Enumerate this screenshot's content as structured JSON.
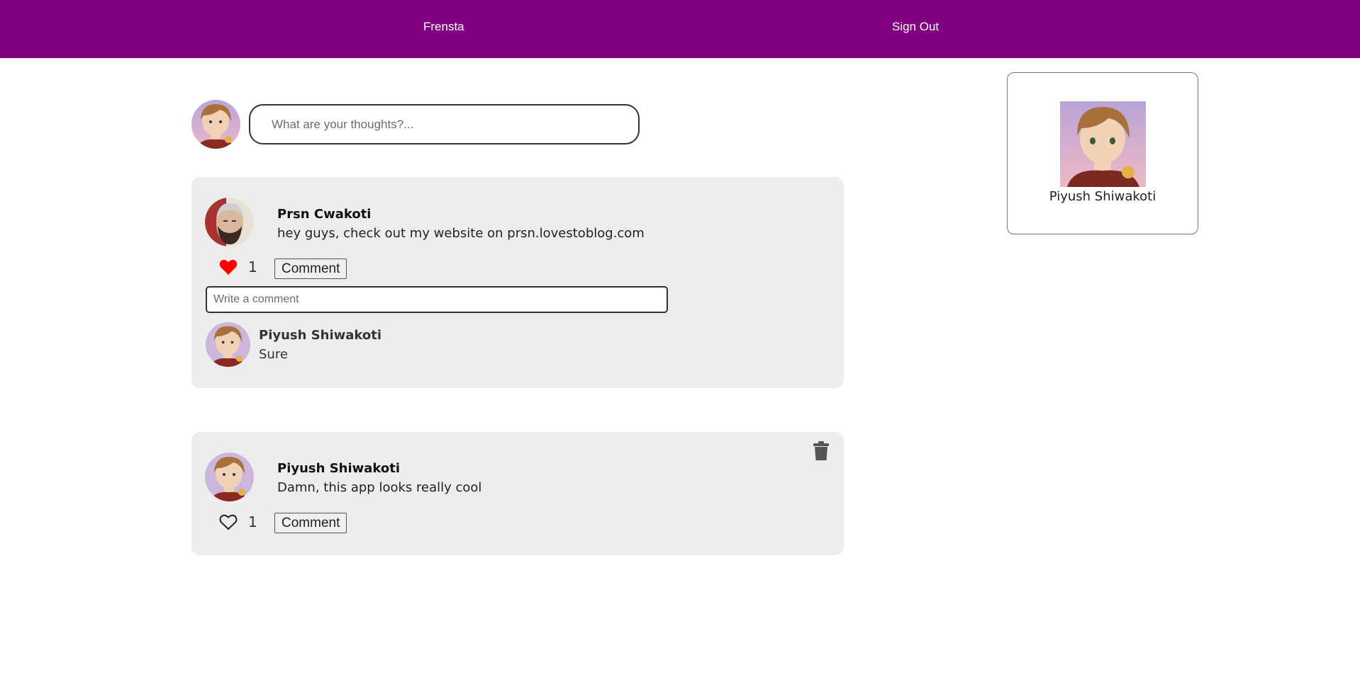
{
  "nav": {
    "brand": "Frensta",
    "sign_out": "Sign Out",
    "background": "#800080"
  },
  "composer": {
    "placeholder": "What are your thoughts?..."
  },
  "posts": [
    {
      "author": "Prsn Cwakoti",
      "text": "hey guys, check out my website on prsn.lovestoblog.com",
      "likes": "1",
      "liked": true,
      "comment_label": "Comment",
      "comment_placeholder": "Write a comment",
      "comments": [
        {
          "author": "Piyush Shiwakoti",
          "text": "Sure"
        }
      ]
    },
    {
      "author": "Piyush Shiwakoti",
      "text": "Damn, this app looks really cool",
      "likes": "1",
      "liked": false,
      "comment_label": "Comment",
      "deletable": true
    }
  ],
  "profile": {
    "name": "Piyush Shiwakoti"
  },
  "colors": {
    "accent": "#800080",
    "card_bg": "#ededed",
    "like_red": "#ff0000"
  },
  "icons": [
    "heart-filled-icon",
    "heart-outline-icon",
    "trash-icon"
  ]
}
